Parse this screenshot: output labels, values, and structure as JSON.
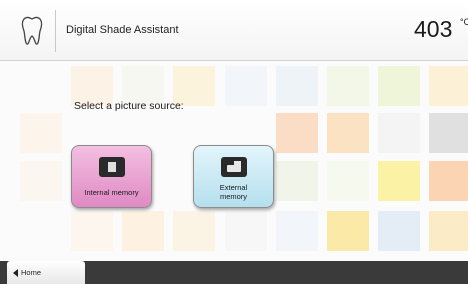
{
  "header": {
    "logo_icon": "tooth-icon",
    "title": "Digital Shade Assistant",
    "temperature": "403",
    "temperature_unit": "°C"
  },
  "main": {
    "prompt": "Select a picture source:",
    "sources": [
      {
        "label": "Internal memory",
        "icon": "memory-chip-icon",
        "color": "#e08ac4"
      },
      {
        "label": "External\nmemory",
        "icon": "memory-card-icon",
        "color": "#b5dfee"
      }
    ]
  },
  "footer": {
    "home_label": "Home",
    "home_icon": "arrow-left-icon"
  },
  "colors": {
    "header_bg": "#f4f4f4",
    "footer_bg": "#3a3a3a",
    "tile_palette": [
      "#fdf0e0",
      "#fce4cc",
      "#fbd6b6",
      "#f7ead0",
      "#fae6b0",
      "#fbe9a4",
      "#e7eef6",
      "#dce8f2",
      "#ebeef0",
      "#e1e1e1",
      "#f3f7df"
    ]
  }
}
